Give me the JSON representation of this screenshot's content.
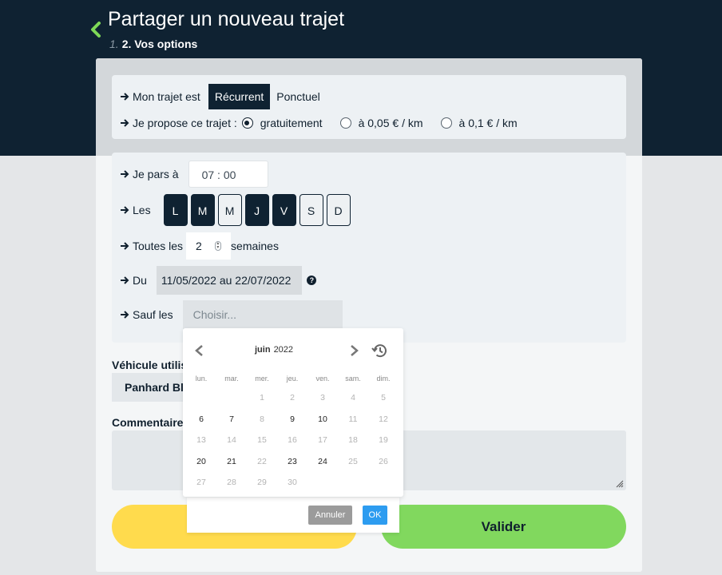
{
  "header": {
    "title": "Partager un nouveau trajet",
    "step_prev": "1.",
    "step_current": "2. Vos options"
  },
  "trip_type": {
    "label": "Mon trajet est",
    "options": [
      "Récurrent",
      "Ponctuel"
    ],
    "selected": "Récurrent"
  },
  "pricing": {
    "label": "Je propose ce trajet :",
    "options": [
      "gratuitement",
      "à 0,05 € / km",
      "à 0,1 € / km"
    ],
    "selected": "gratuitement"
  },
  "departure": {
    "label": "Je pars à",
    "time": "07 : 00"
  },
  "days": {
    "label": "Les",
    "items": [
      {
        "letter": "L",
        "active": true
      },
      {
        "letter": "M",
        "active": true
      },
      {
        "letter": "M",
        "active": false
      },
      {
        "letter": "J",
        "active": true
      },
      {
        "letter": "V",
        "active": true
      },
      {
        "letter": "S",
        "active": false
      },
      {
        "letter": "D",
        "active": false
      }
    ]
  },
  "frequency": {
    "label_before": "Toutes les",
    "value": "2",
    "label_after": "semaines"
  },
  "period": {
    "label": "Du",
    "value": "11/05/2022 au 22/07/2022",
    "help_icon": "question-circle-icon"
  },
  "except": {
    "label": "Sauf les",
    "placeholder": "Choisir..."
  },
  "vehicle": {
    "label": "Véhicule utilise",
    "value": "Panhard Ble"
  },
  "comments": {
    "label": "Commentaires"
  },
  "actions": {
    "validate": "Valider"
  },
  "datepicker": {
    "month": "juin",
    "year": "2022",
    "weekdays": [
      "lun.",
      "mar.",
      "mer.",
      "jeu.",
      "ven.",
      "sam.",
      "dim."
    ],
    "weeks": [
      [
        {
          "d": "",
          "s": "e"
        },
        {
          "d": "",
          "s": "e"
        },
        {
          "d": "1",
          "s": "dim"
        },
        {
          "d": "2",
          "s": "dim"
        },
        {
          "d": "3",
          "s": "dim"
        },
        {
          "d": "4",
          "s": "dim"
        },
        {
          "d": "5",
          "s": "dim"
        }
      ],
      [
        {
          "d": "6",
          "s": "act"
        },
        {
          "d": "7",
          "s": "act"
        },
        {
          "d": "8",
          "s": "dim"
        },
        {
          "d": "9",
          "s": "act"
        },
        {
          "d": "10",
          "s": "act"
        },
        {
          "d": "11",
          "s": "dim"
        },
        {
          "d": "12",
          "s": "dim"
        }
      ],
      [
        {
          "d": "13",
          "s": "dim"
        },
        {
          "d": "14",
          "s": "dim"
        },
        {
          "d": "15",
          "s": "dim"
        },
        {
          "d": "16",
          "s": "dim"
        },
        {
          "d": "17",
          "s": "dim"
        },
        {
          "d": "18",
          "s": "dim"
        },
        {
          "d": "19",
          "s": "dim"
        }
      ],
      [
        {
          "d": "20",
          "s": "act"
        },
        {
          "d": "21",
          "s": "act"
        },
        {
          "d": "22",
          "s": "dim"
        },
        {
          "d": "23",
          "s": "act"
        },
        {
          "d": "24",
          "s": "act"
        },
        {
          "d": "25",
          "s": "dim"
        },
        {
          "d": "26",
          "s": "dim"
        }
      ],
      [
        {
          "d": "27",
          "s": "dim"
        },
        {
          "d": "28",
          "s": "dim"
        },
        {
          "d": "29",
          "s": "dim"
        },
        {
          "d": "30",
          "s": "dim"
        },
        {
          "d": "",
          "s": "e"
        },
        {
          "d": "",
          "s": "e"
        },
        {
          "d": "",
          "s": "e"
        }
      ]
    ],
    "cancel_label": "Annuler",
    "ok_label": "OK"
  },
  "colors": {
    "navy": "#0f2232",
    "yellow": "#ffdb4d",
    "green": "#81d85e",
    "back_arrow": "#7ed957",
    "ok_blue": "#2d9cf0"
  }
}
